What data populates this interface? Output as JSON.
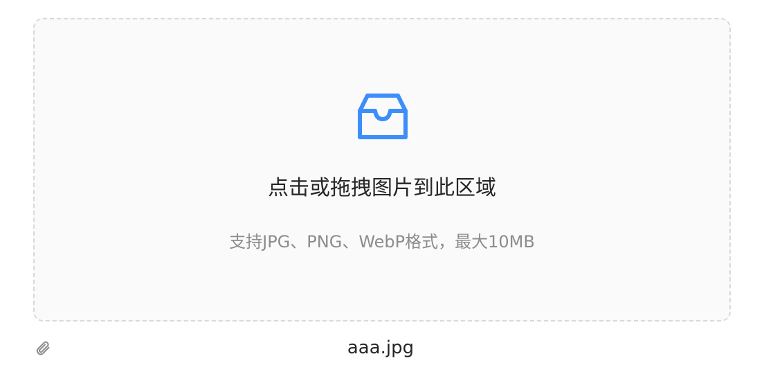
{
  "upload": {
    "title": "点击或拖拽图片到此区域",
    "hint": "支持JPG、PNG、WebP格式，最大10MB",
    "icon": "inbox-icon",
    "accent_color": "#3d8ef8",
    "border_color": "#d9d9d9",
    "background_color": "#fafafa"
  },
  "file_list": {
    "items": [
      {
        "name": "aaa.jpg",
        "icon": "paperclip-icon"
      }
    ]
  }
}
